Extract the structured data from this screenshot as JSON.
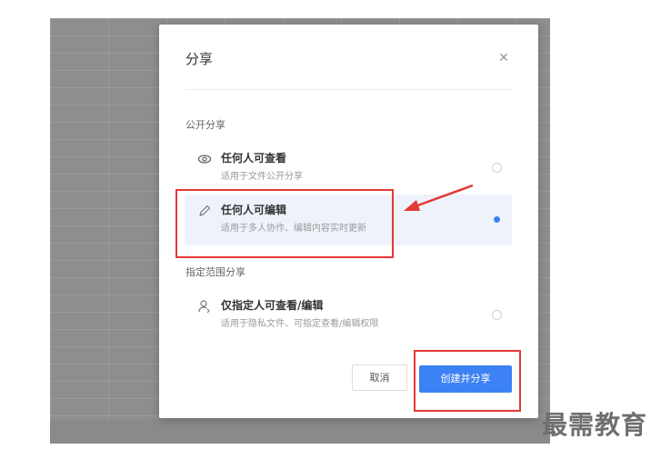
{
  "dialog": {
    "title": "分享",
    "close_icon": "close-icon",
    "public_section_label": "公开分享",
    "scoped_section_label": "指定范围分享",
    "options": [
      {
        "title": "任何人可查看",
        "desc": "适用于文件公开分享",
        "icon": "eye-icon",
        "selected": false
      },
      {
        "title": "任何人可编辑",
        "desc": "适用于多人协作、编辑内容实时更新",
        "icon": "pencil-icon",
        "selected": true
      },
      {
        "title": "仅指定人可查看/编辑",
        "desc": "适用于隐私文件、可指定查看/编辑权限",
        "icon": "person-icon",
        "selected": false
      }
    ],
    "cancel_label": "取消",
    "create_label": "创建并分享"
  },
  "colors": {
    "accent": "#3d82f4",
    "highlight": "#e53935",
    "selected_bg": "#eef2fb"
  },
  "watermark": "最需教育"
}
